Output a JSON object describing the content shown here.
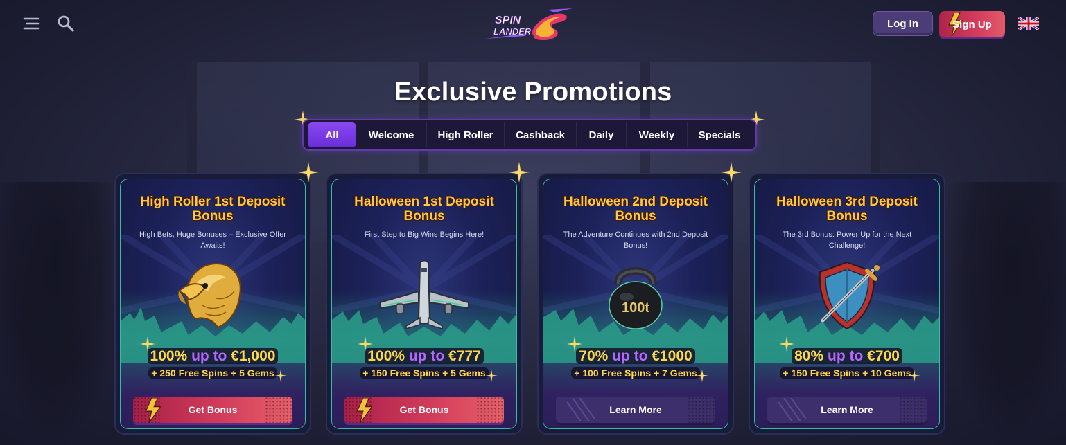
{
  "header": {
    "menu_icon": "menu-icon",
    "search_icon": "search-icon",
    "logo_text_1": "SPIN",
    "logo_text_2": "LANDER",
    "login_label": "Log In",
    "signup_label": "Sign Up",
    "language_flag": "uk-flag-icon"
  },
  "page": {
    "title": "Exclusive Promotions"
  },
  "tabs": [
    {
      "label": "All",
      "active": true
    },
    {
      "label": "Welcome",
      "active": false
    },
    {
      "label": "High Roller",
      "active": false
    },
    {
      "label": "Cashback",
      "active": false
    },
    {
      "label": "Daily",
      "active": false
    },
    {
      "label": "Weekly",
      "active": false
    },
    {
      "label": "Specials",
      "active": false
    }
  ],
  "promotions": [
    {
      "title": "High Roller 1st Deposit Bonus",
      "subtitle": "High Bets, Huge Bonuses – Exclusive Offer Awaits!",
      "art_icon": "eagle-icon",
      "percent": "100%",
      "up_to": "up to",
      "max": "€1,000",
      "extras": "+ 250 Free Spins + 5 Gems",
      "button": "Get Bonus",
      "button_style": "primary"
    },
    {
      "title": "Halloween 1st Deposit Bonus",
      "subtitle": "First Step to Big Wins Begins Here!",
      "art_icon": "airplane-icon",
      "percent": "100%",
      "up_to": "up to",
      "max": "€777",
      "extras": "+ 150 Free Spins + 5 Gems",
      "button": "Get Bonus",
      "button_style": "primary"
    },
    {
      "title": "Halloween 2nd Deposit Bonus",
      "subtitle": "The Adventure Continues with 2nd Deposit Bonus!",
      "art_icon": "kettlebell-icon",
      "art_label": "100t",
      "percent": "70%",
      "up_to": "up to",
      "max": "€1000",
      "extras": "+ 100 Free Spins + 7 Gems",
      "button": "Learn More",
      "button_style": "secondary"
    },
    {
      "title": "Halloween 3rd Deposit Bonus",
      "subtitle": "The 3rd Bonus: Power Up for the Next Challenge!",
      "art_icon": "shield-sword-icon",
      "percent": "80%",
      "up_to": "up to",
      "max": "€700",
      "extras": "+ 150 Free Spins + 10 Gems",
      "button": "Learn More",
      "button_style": "secondary"
    }
  ],
  "colors": {
    "background": "#1d1e33",
    "accent_purple": "#7a3ae6",
    "title_gold": "#ffc64a",
    "up_to_purple": "#b566ff",
    "teal_border": "#2fbfa6",
    "cta_red": "#d23c5b"
  }
}
